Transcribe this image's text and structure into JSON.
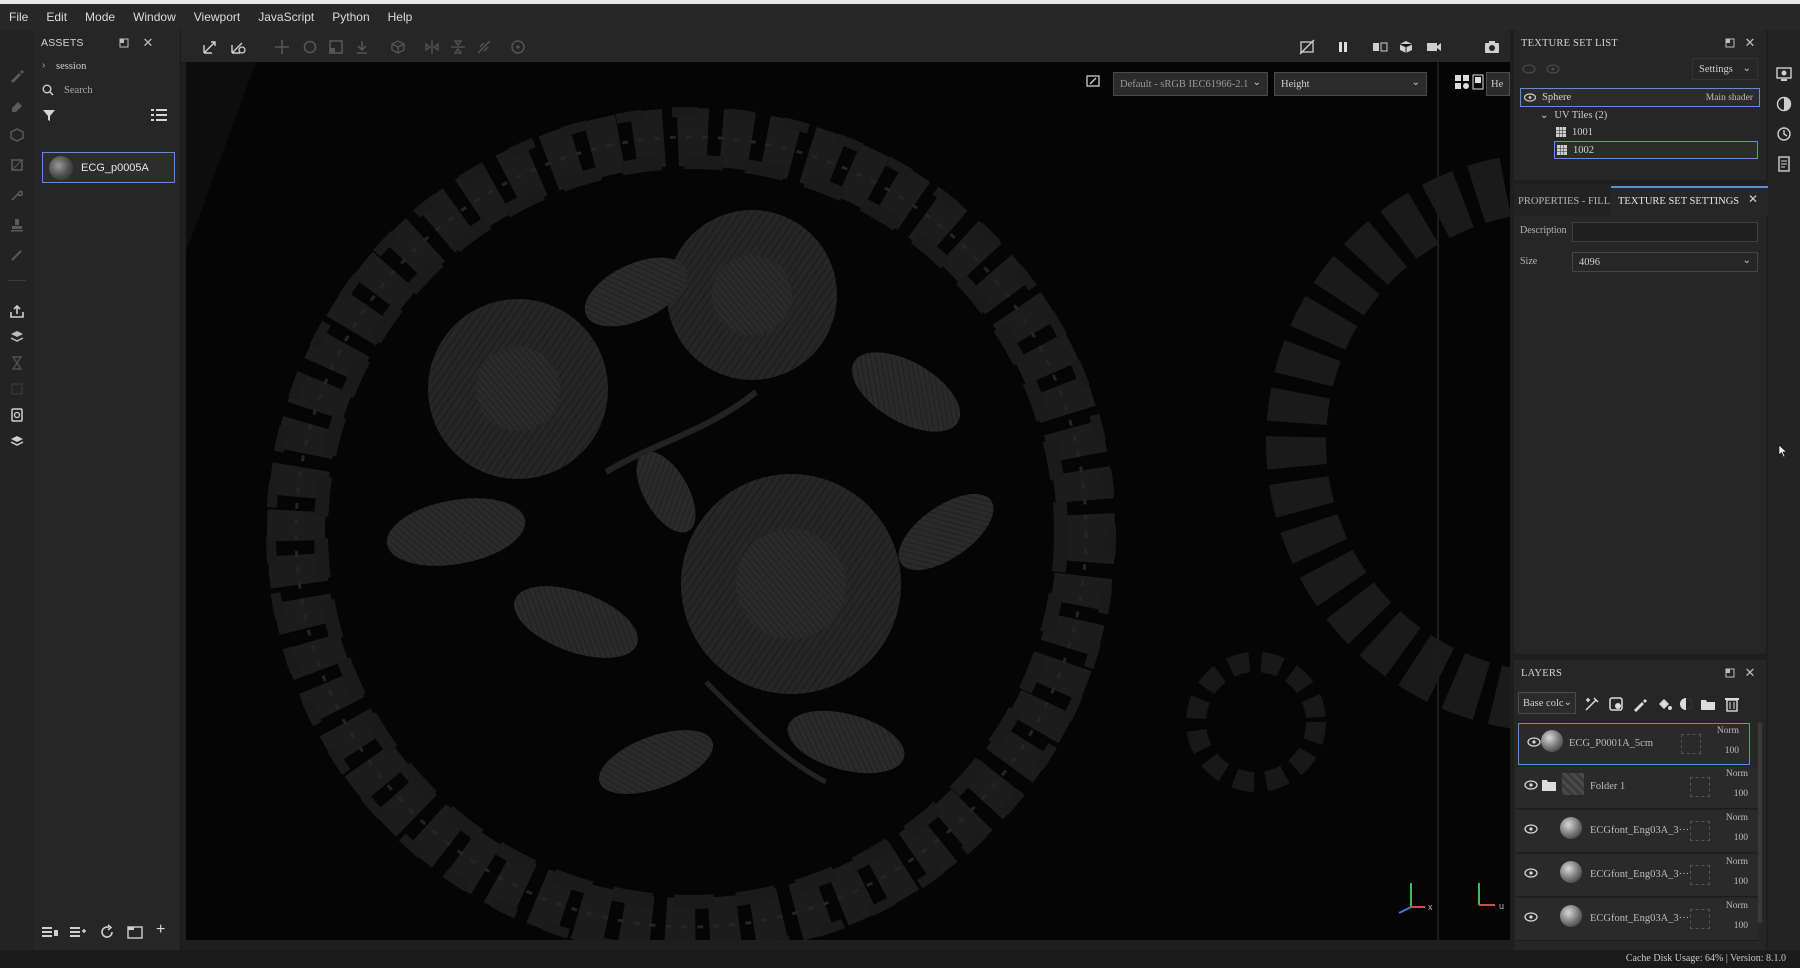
{
  "menu": [
    "File",
    "Edit",
    "Mode",
    "Window",
    "Viewport",
    "JavaScript",
    "Python",
    "Help"
  ],
  "assets": {
    "title": "ASSETS",
    "tree_item": "session",
    "search_placeholder": "Search",
    "asset_name": "ECG_p0005A"
  },
  "viewport": {
    "color_profile": "Default - sRGB IEC61966-2.1",
    "channel": "Height",
    "right_label": "He",
    "axis_x": "x",
    "axis_u": "u"
  },
  "texture_set_list": {
    "title": "TEXTURE SET LIST",
    "settings_label": "Settings",
    "set_name": "Sphere",
    "shader": "Main shader",
    "uv_group": "UV Tiles (2)",
    "tiles": [
      "1001",
      "1002"
    ]
  },
  "properties": {
    "tab1": "PROPERTIES - FILL",
    "tab2": "TEXTURE SET SETTINGS",
    "description_label": "Description",
    "description_value": "",
    "size_label": "Size",
    "size_value": "4096"
  },
  "layers": {
    "title": "LAYERS",
    "channel_select": "Base colc",
    "items": [
      {
        "name": "ECG_P0001A_5cm",
        "blend": "Norm",
        "opacity": "100"
      },
      {
        "name": "Folder 1",
        "blend": "Norm",
        "opacity": "100"
      },
      {
        "name": "ECGfont_Eng03A_3···",
        "blend": "Norm",
        "opacity": "100"
      },
      {
        "name": "ECGfont_Eng03A_3···",
        "blend": "Norm",
        "opacity": "100"
      },
      {
        "name": "ECGfont_Eng03A_3···",
        "blend": "Norm",
        "opacity": "100"
      }
    ]
  },
  "status": {
    "text": "Cache Disk Usage:   64% | Version: 8.1.0"
  },
  "colors": {
    "accent": "#5e8fd6",
    "panel": "#262626",
    "viewport": "#050505"
  }
}
